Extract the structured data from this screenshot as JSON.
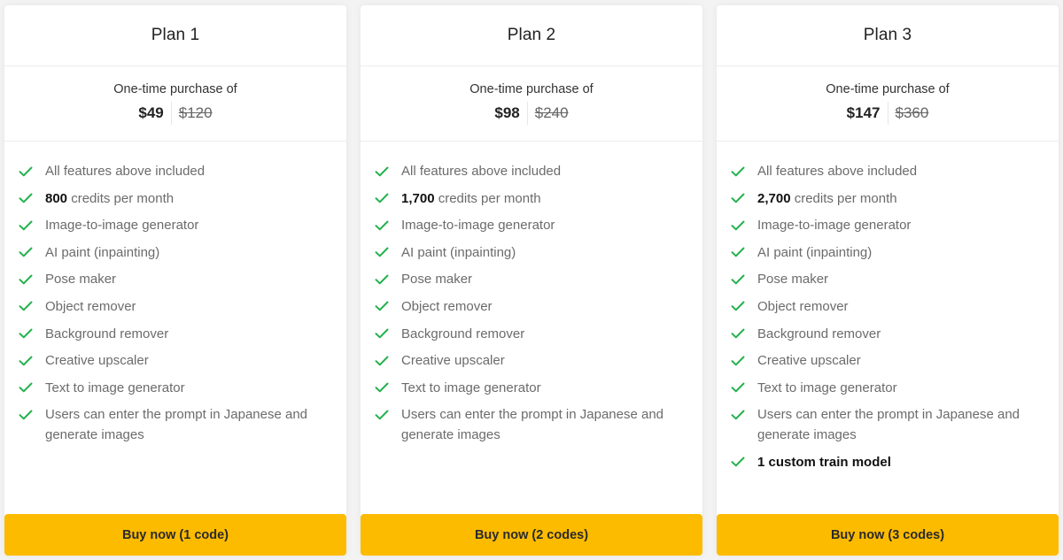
{
  "colors": {
    "accent": "#fdbb00",
    "check": "#22b14c",
    "background": "#f3f3f3"
  },
  "plans": [
    {
      "title": "Plan 1",
      "price_caption": "One-time purchase of",
      "price": "$49",
      "original_price": "$120",
      "features": [
        {
          "bold": "",
          "text": "All features above included"
        },
        {
          "bold": "800",
          "text": " credits per month"
        },
        {
          "bold": "",
          "text": "Image-to-image generator"
        },
        {
          "bold": "",
          "text": "AI paint (inpainting)"
        },
        {
          "bold": "",
          "text": "Pose maker"
        },
        {
          "bold": "",
          "text": "Object remover"
        },
        {
          "bold": "",
          "text": "Background remover"
        },
        {
          "bold": "",
          "text": "Creative upscaler"
        },
        {
          "bold": "",
          "text": "Text to image generator"
        },
        {
          "bold": "",
          "text": "Users can enter the prompt in Japanese and generate images"
        }
      ],
      "button_label": "Buy now (1 code)"
    },
    {
      "title": "Plan 2",
      "price_caption": "One-time purchase of",
      "price": "$98",
      "original_price": "$240",
      "features": [
        {
          "bold": "",
          "text": "All features above included"
        },
        {
          "bold": "1,700",
          "text": " credits per month"
        },
        {
          "bold": "",
          "text": "Image-to-image generator"
        },
        {
          "bold": "",
          "text": "AI paint (inpainting)"
        },
        {
          "bold": "",
          "text": "Pose maker"
        },
        {
          "bold": "",
          "text": "Object remover"
        },
        {
          "bold": "",
          "text": "Background remover"
        },
        {
          "bold": "",
          "text": "Creative upscaler"
        },
        {
          "bold": "",
          "text": "Text to image generator"
        },
        {
          "bold": "",
          "text": "Users can enter the prompt in Japanese and generate images"
        }
      ],
      "button_label": "Buy now (2 codes)"
    },
    {
      "title": "Plan 3",
      "price_caption": "One-time purchase of",
      "price": "$147",
      "original_price": "$360",
      "features": [
        {
          "bold": "",
          "text": "All features above included"
        },
        {
          "bold": "2,700",
          "text": " credits per month"
        },
        {
          "bold": "",
          "text": "Image-to-image generator"
        },
        {
          "bold": "",
          "text": "AI paint (inpainting)"
        },
        {
          "bold": "",
          "text": "Pose maker"
        },
        {
          "bold": "",
          "text": "Object remover"
        },
        {
          "bold": "",
          "text": "Background remover"
        },
        {
          "bold": "",
          "text": "Creative upscaler"
        },
        {
          "bold": "",
          "text": "Text to image generator"
        },
        {
          "bold": "",
          "text": "Users can enter the prompt in Japanese and generate images"
        },
        {
          "bold": "1 custom train model",
          "text": ""
        }
      ],
      "button_label": "Buy now (3 codes)"
    }
  ],
  "icons": {
    "feature_bullet": "check-icon"
  }
}
